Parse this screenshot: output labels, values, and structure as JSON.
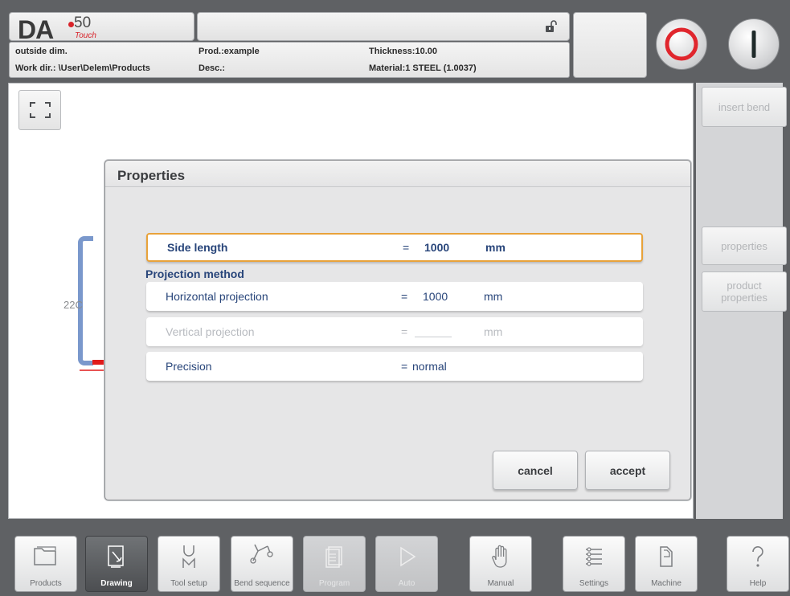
{
  "header": {
    "logo_text": "DA",
    "logo_model": "50",
    "logo_suffix": "Touch",
    "status_message": "",
    "info": {
      "mode": "outside dim.",
      "work_dir": "Work dir.: \\User\\Delem\\Products",
      "product": "Prod.:example",
      "description": "Desc.:",
      "thickness": "Thickness:10.00",
      "material": "Material:1 STEEL (1.0037)"
    },
    "stop_color": "#e0262d",
    "start_color": "#1f2a2a"
  },
  "side_buttons": {
    "insert_bend": "insert bend",
    "properties": "properties",
    "product_properties": "product properties"
  },
  "canvas": {
    "partial_label": "22C",
    "fit_icon": "fit-view-icon"
  },
  "dialog": {
    "title": "Properties",
    "side_length": {
      "label": "Side length",
      "eq": "=",
      "value": "1000",
      "unit": "mm"
    },
    "projection_method_label": "Projection method",
    "horizontal_projection": {
      "label": "Horizontal projection",
      "eq": "=",
      "value": "1000",
      "unit": "mm"
    },
    "vertical_projection": {
      "label": "Vertical projection",
      "eq": "=",
      "value": "",
      "unit": "mm"
    },
    "precision": {
      "label": "Precision",
      "eq": "=",
      "value": "normal"
    },
    "cancel_label": "cancel",
    "accept_label": "accept"
  },
  "toolbar": {
    "items": [
      {
        "label": "Products",
        "icon": "folder-icon"
      },
      {
        "label": "Drawing",
        "icon": "drawing-icon"
      },
      {
        "label": "Tool setup",
        "icon": "tool-setup-icon"
      },
      {
        "label": "Bend sequence",
        "icon": "bend-sequence-icon"
      },
      {
        "label": "Program",
        "icon": "program-icon"
      },
      {
        "label": "Auto",
        "icon": "play-icon"
      },
      {
        "label": "Manual",
        "icon": "hand-icon"
      },
      {
        "label": "Settings",
        "icon": "settings-list-icon"
      },
      {
        "label": "Machine",
        "icon": "machine-icon"
      },
      {
        "label": "Help",
        "icon": "help-icon"
      }
    ]
  }
}
